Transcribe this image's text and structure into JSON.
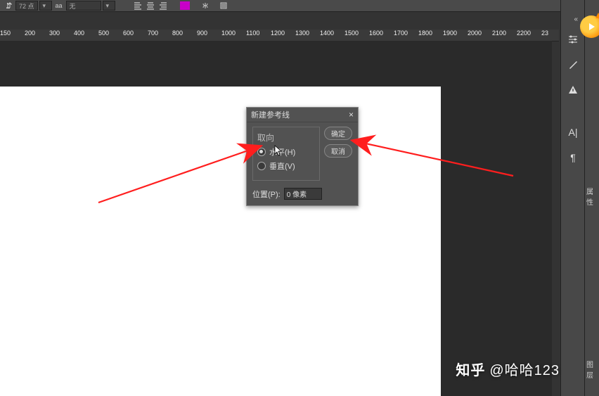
{
  "toolbar": {
    "font_size_val": "72 点",
    "aa_label": "aa",
    "antialias": "无",
    "align_icons": [
      "align-left-icon",
      "align-center-icon",
      "align-right-icon"
    ],
    "swatch_color": "#c800c8"
  },
  "ruler": [
    "150",
    "200",
    "300",
    "400",
    "500",
    "600",
    "700",
    "800",
    "900",
    "1000",
    "1100",
    "1200",
    "1300",
    "1400",
    "1500",
    "1600",
    "1700",
    "1800",
    "1900",
    "2000",
    "2100",
    "2200",
    "23"
  ],
  "dialog": {
    "title": "新建参考线",
    "close": "×",
    "group_label": "取向",
    "radio_h": "水平(H)",
    "radio_v": "垂直(V)",
    "selected": "h",
    "ok": "确定",
    "cancel": "取消",
    "position_label": "位置(P):",
    "position_value": "0 像素"
  },
  "panels": {
    "properties": "属性",
    "layers": "图层"
  },
  "watermark": {
    "logo": "知乎",
    "user": "@哈哈123"
  }
}
